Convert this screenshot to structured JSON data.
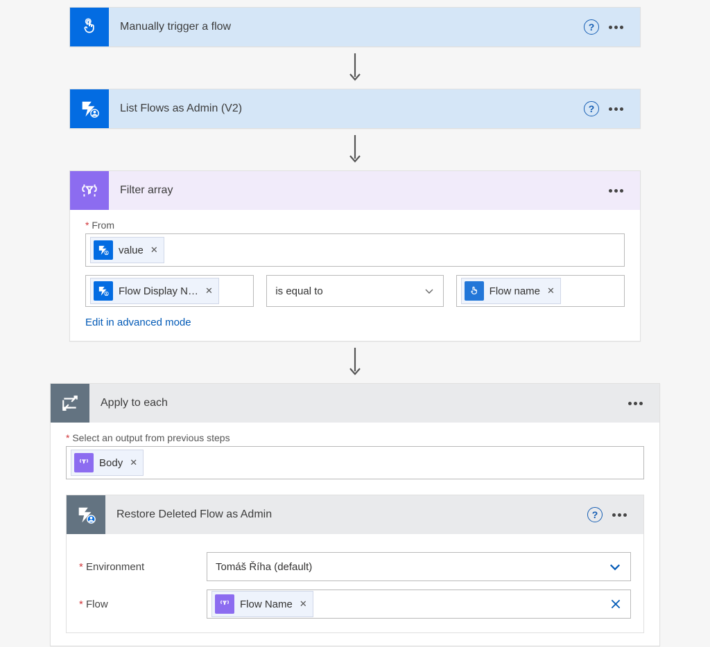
{
  "trigger": {
    "title": "Manually trigger a flow"
  },
  "list_flows": {
    "title": "List Flows as Admin (V2)"
  },
  "filter_array": {
    "title": "Filter array",
    "from_label": "From",
    "from_token": "value",
    "left_token": "Flow Display N…",
    "operator": "is equal to",
    "right_token": "Flow name",
    "advanced_link": "Edit in advanced mode"
  },
  "apply_each": {
    "title": "Apply to each",
    "select_label": "Select an output from previous steps",
    "body_token": "Body"
  },
  "restore": {
    "title": "Restore Deleted Flow as Admin",
    "env_label": "Environment",
    "env_value": "Tomáš Říha (default)",
    "flow_label": "Flow",
    "flow_token": "Flow Name"
  }
}
